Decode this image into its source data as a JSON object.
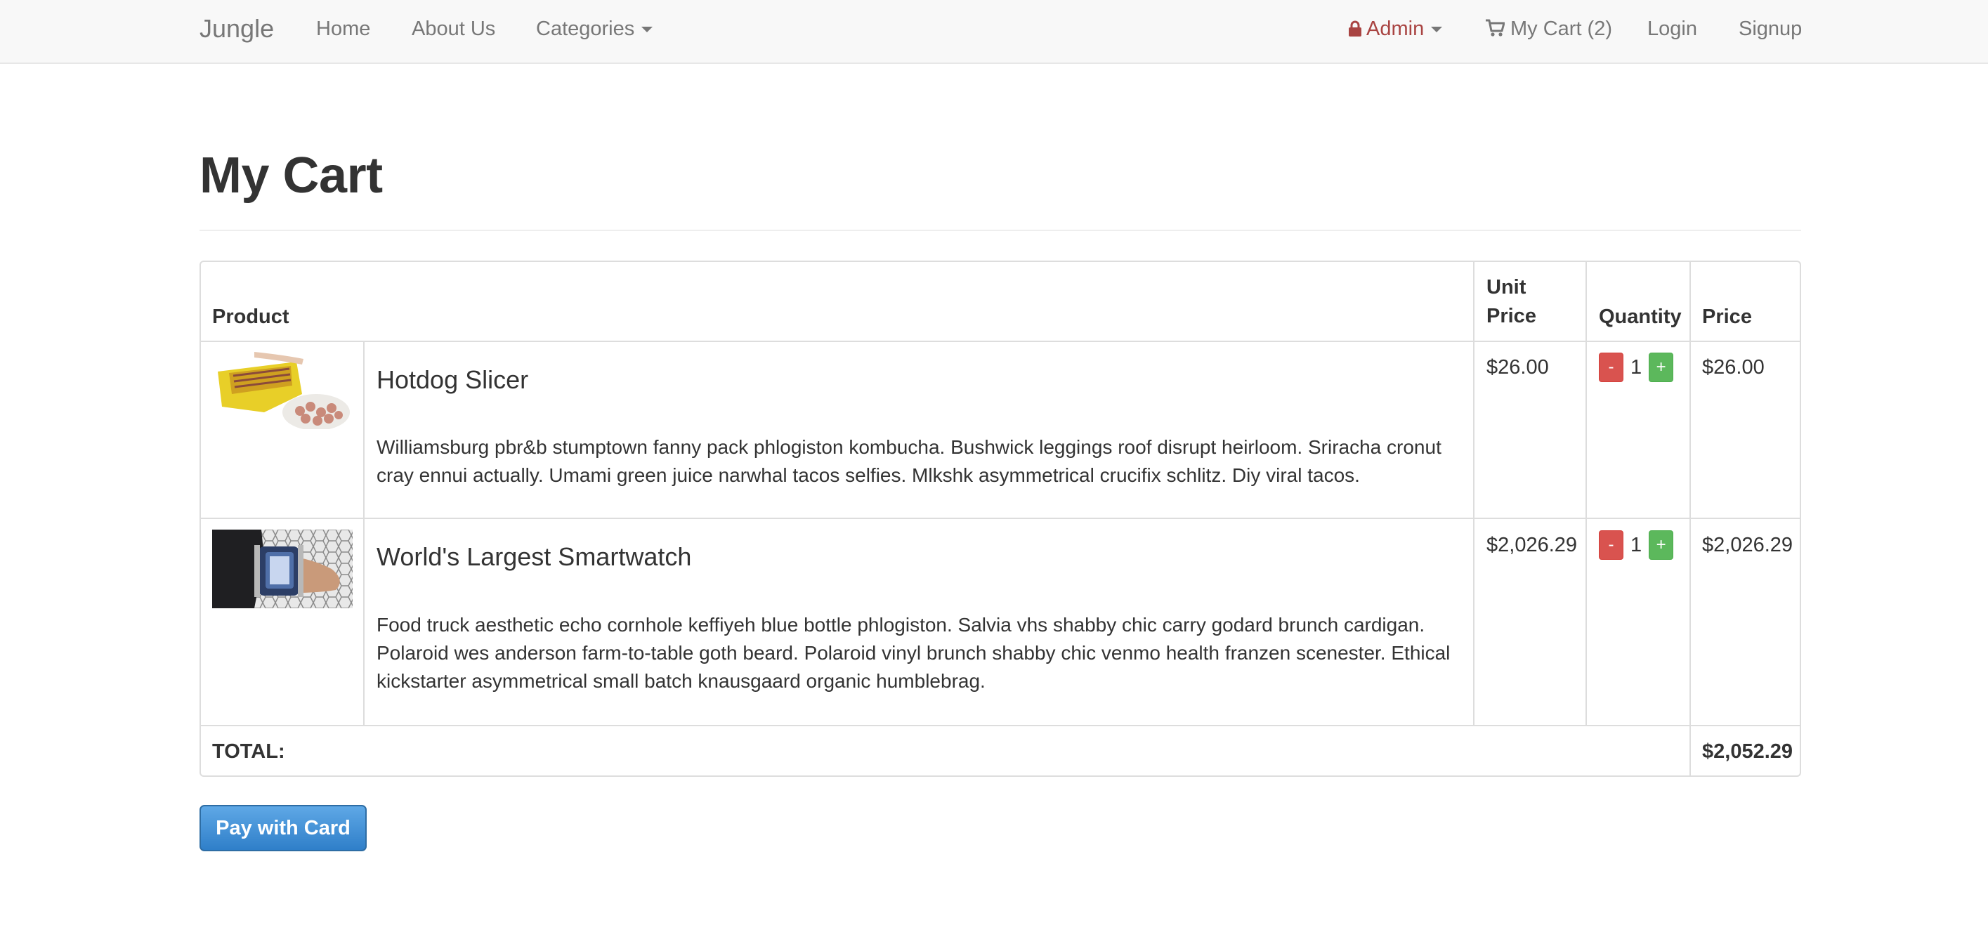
{
  "navbar": {
    "brand": "Jungle",
    "links": {
      "home": "Home",
      "about": "About Us",
      "categories": "Categories"
    },
    "admin": "Admin",
    "cart": "My Cart (2)",
    "login": "Login",
    "signup": "Signup"
  },
  "page": {
    "title": "My Cart"
  },
  "table": {
    "headers": {
      "product": "Product",
      "unit_price": "Unit Price",
      "quantity": "Quantity",
      "price": "Price"
    },
    "items": [
      {
        "name": "Hotdog Slicer",
        "description": "Williamsburg pbr&b stumptown fanny pack phlogiston kombucha. Bushwick leggings roof disrupt heirloom. Sriracha cronut cray ennui actually. Umami green juice narwhal tacos selfies. Mlkshk asymmetrical crucifix schlitz. Diy viral tacos.",
        "unit_price": "$26.00",
        "quantity": "1",
        "price": "$26.00",
        "minus": "-",
        "plus": "+"
      },
      {
        "name": "World's Largest Smartwatch",
        "description": "Food truck aesthetic echo cornhole keffiyeh blue bottle phlogiston. Salvia vhs shabby chic carry godard brunch cardigan. Polaroid wes anderson farm-to-table goth beard. Polaroid vinyl brunch shabby chic venmo health franzen scenester. Ethical kickstarter asymmetrical small batch knausgaard organic humblebrag.",
        "unit_price": "$2,026.29",
        "quantity": "1",
        "price": "$2,026.29",
        "minus": "-",
        "plus": "+"
      }
    ],
    "total_label": "TOTAL:",
    "total_value": "$2,052.29"
  },
  "actions": {
    "pay": "Pay with Card"
  },
  "colors": {
    "admin": "#a94442",
    "minus": "#d9534f",
    "plus": "#5cb85c",
    "pay": "#3a8bd8"
  },
  "icons": {
    "admin": "lock-icon",
    "cart": "shopping-cart-icon",
    "dropdown": "caret-down-icon"
  }
}
